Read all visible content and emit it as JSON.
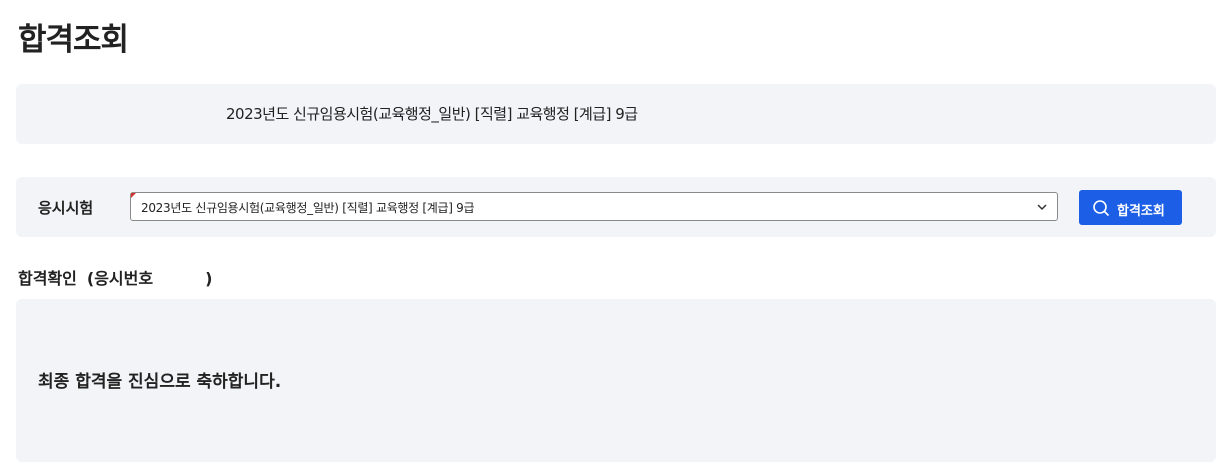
{
  "page": {
    "title": "합격조회"
  },
  "banner": {
    "exam_text": "2023년도 신규임용시험(교육행정_일반) [직렬] 교육행정 [계급] 9급"
  },
  "search": {
    "label": "응시시험",
    "selected_exam": "2023년도 신규임용시험(교육행정_일반) [직렬] 교육행정 [계급] 9급",
    "button_label": "합격조회",
    "button_icon": "search-icon",
    "button_color": "#1c5fe6"
  },
  "result": {
    "heading": "합격확인",
    "applicant_number_label": "(응시번호",
    "applicant_number_close": ")",
    "message": "최종 합격을 진심으로 축하합니다."
  },
  "colors": {
    "panel_background": "#f3f4f7",
    "accent": "#1c5fe6"
  }
}
